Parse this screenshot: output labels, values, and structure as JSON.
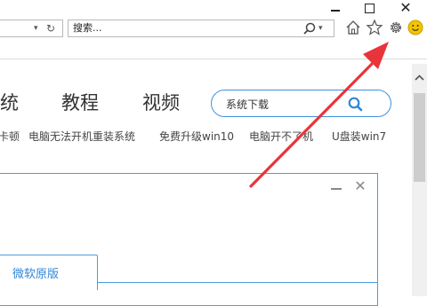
{
  "window": {
    "minimize": "minimize",
    "maximize": "maximize",
    "close_glyph": "✕"
  },
  "address_bar": {
    "dropdown_glyph": "▾",
    "refresh_glyph": "↻"
  },
  "search_bar": {
    "placeholder": "搜索...",
    "dropdown_glyph": "▾"
  },
  "toolbar": {
    "icons": [
      "home-icon",
      "star-icon",
      "gear-icon",
      "smiley-icon"
    ]
  },
  "site": {
    "nav": [
      "统",
      "教程",
      "视频"
    ],
    "search_placeholder": "系统下载",
    "links": [
      "卡顿",
      "电脑无法开机重装系统",
      "免费升级win10",
      "电脑开不了机",
      "U盘装win7"
    ]
  },
  "dialog": {
    "tab_label": "微软原版",
    "close_glyph": "✕"
  },
  "colors": {
    "accent_blue": "#3f8fe0",
    "arrow_red": "#e8343a",
    "smiley_yellow": "#f2c500"
  }
}
